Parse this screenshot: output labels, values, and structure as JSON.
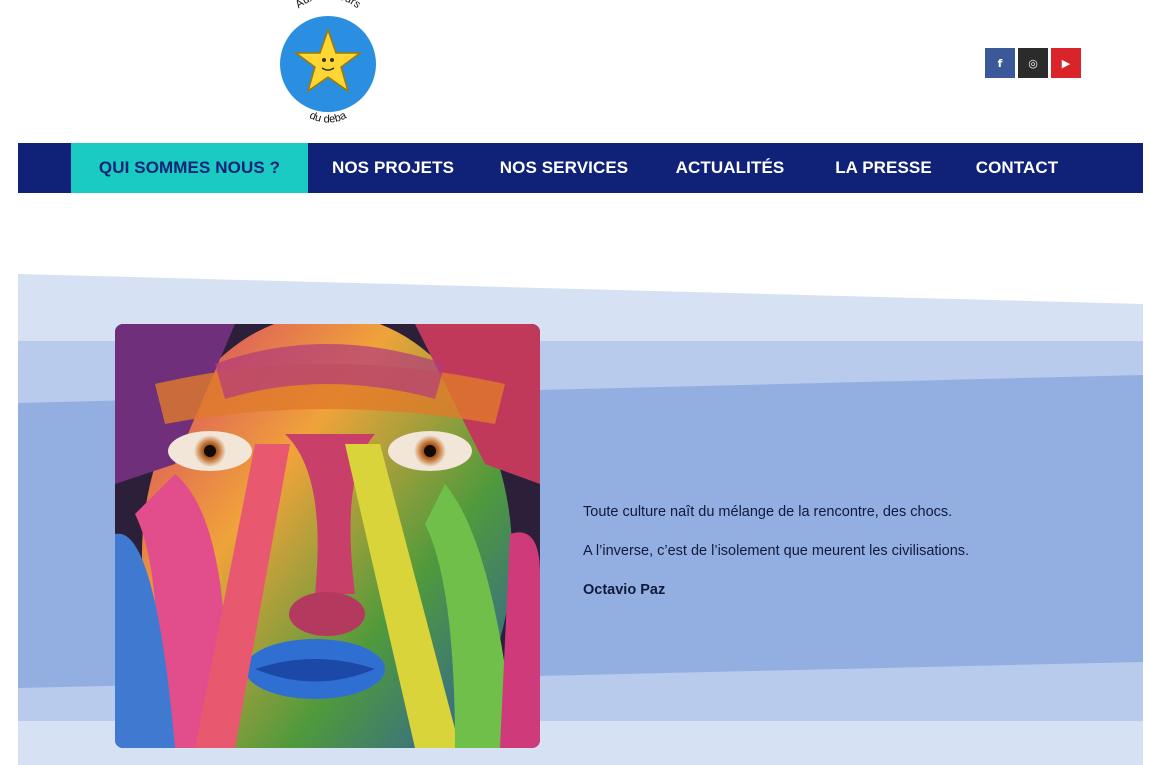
{
  "brand": {
    "logo_top_text": "Aux couleurs",
    "logo_bottom_text": "du deba"
  },
  "social": [
    {
      "name": "Facebook",
      "glyph": "f"
    },
    {
      "name": "Instagram",
      "glyph": "◎"
    },
    {
      "name": "YouTube",
      "glyph": "▶"
    }
  ],
  "nav": {
    "items": [
      {
        "label": "QUI SOMMES NOUS ?",
        "active": true
      },
      {
        "label": "NOS PROJETS",
        "active": false
      },
      {
        "label": "NOS SERVICES",
        "active": false
      },
      {
        "label": "ACTUALITÉS",
        "active": false
      },
      {
        "label": "LA PRESSE",
        "active": false
      },
      {
        "label": "CONTACT",
        "active": false
      }
    ]
  },
  "quote": {
    "line1": "Toute culture naît du mélange de la rencontre, des chocs.",
    "line2": "A l’inverse, c’est de l’isolement que meurent les civilisations.",
    "author": "Octavio Paz"
  },
  "colors": {
    "nav_bg": "#0f2277",
    "nav_active": "#19cbc2",
    "band_light": "#d6e1f4",
    "band_mid": "#b8cbed",
    "band_dark": "#93afe2"
  }
}
